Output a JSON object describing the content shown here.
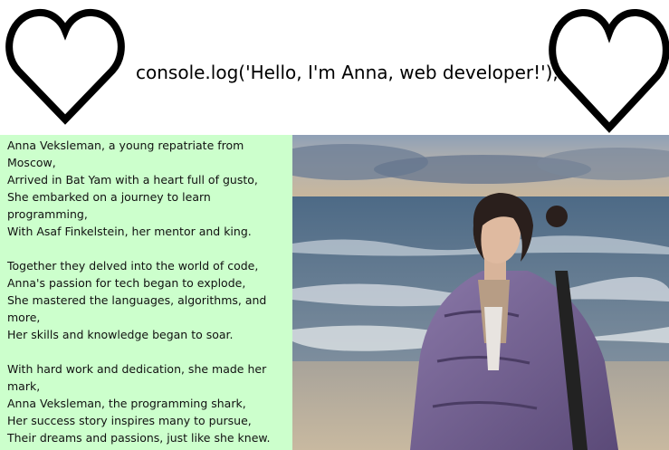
{
  "header": {
    "greeting": "console.log('Hello, I'm Anna, web developer!');",
    "left_icon": "heart-outline-icon",
    "right_icon": "heart-outline-icon"
  },
  "poem": {
    "stanzas": [
      {
        "lines": [
          "Anna Veksleman, a young repatriate from",
          "Moscow,",
          "Arrived in Bat Yam with a heart full of gusto,",
          "She embarked on a journey to learn",
          "programming,",
          "With Asaf Finkelstein, her mentor and king."
        ]
      },
      {
        "lines": [
          "Together they delved into the world of code,",
          "Anna's passion for tech began to explode,",
          "She mastered the languages, algorithms, and",
          "more,",
          "Her skills and knowledge began to soar."
        ]
      },
      {
        "lines": [
          "With hard work and dedication, she made her",
          "mark,",
          "Anna Veksleman, the programming shark,",
          "Her success story inspires many to pursue,",
          "Their dreams and passions, just like she knew."
        ]
      }
    ]
  },
  "colors": {
    "poem_background": "#ccffcc",
    "header_background": "#ffffff"
  }
}
